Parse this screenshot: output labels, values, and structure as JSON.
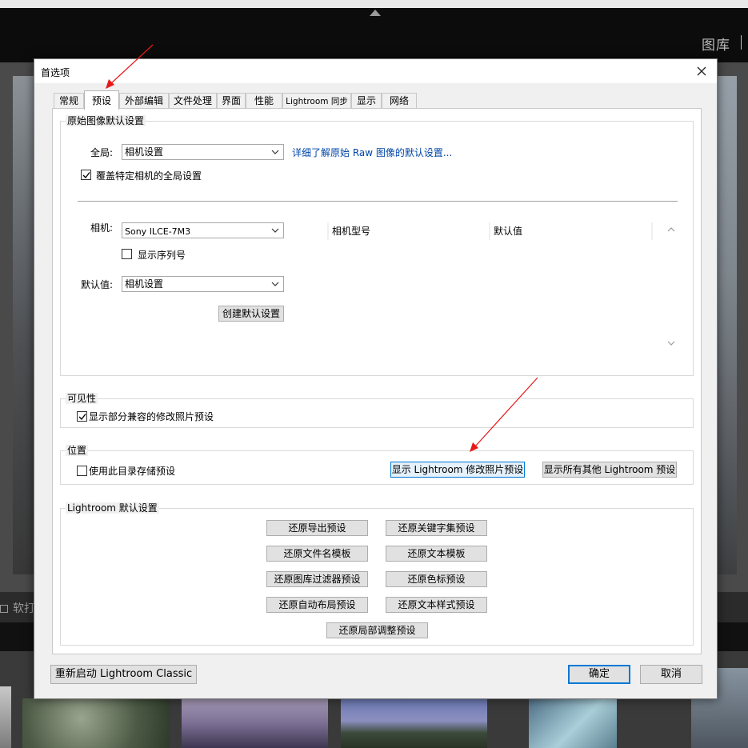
{
  "background": {
    "module_label": "图库",
    "toolbar_label": "软打"
  },
  "dialog": {
    "title": "首选项",
    "tabs": [
      {
        "label": "常规",
        "active": false
      },
      {
        "label": "预设",
        "active": true
      },
      {
        "label": "外部编辑",
        "active": false
      },
      {
        "label": "文件处理",
        "active": false
      },
      {
        "label": "界面",
        "active": false
      },
      {
        "label": "性能",
        "active": false
      },
      {
        "label": "Lightroom 同步",
        "active": false
      },
      {
        "label": "显示",
        "active": false
      },
      {
        "label": "网络",
        "active": false
      }
    ],
    "raw_defaults": {
      "group_label": "原始图像默认设置",
      "global_label": "全局:",
      "global_value": "相机设置",
      "learn_more_link": "详细了解原始 Raw 图像的默认设置...",
      "override_label": "覆盖特定相机的全局设置",
      "override_checked": true,
      "camera_label": "相机:",
      "camera_value": "Sony ILCE-7M3",
      "show_serial_label": "显示序列号",
      "show_serial_checked": false,
      "default_label": "默认值:",
      "default_value": "相机设置",
      "create_default_button": "创建默认设置",
      "table_headers": [
        "相机型号",
        "默认值"
      ]
    },
    "visibility": {
      "group_label": "可见性",
      "show_partial_label": "显示部分兼容的修改照片预设",
      "show_partial_checked": true
    },
    "location": {
      "group_label": "位置",
      "store_with_catalog_label": "使用此目录存储预设",
      "store_with_catalog_checked": false,
      "show_develop_presets_button": "显示 Lightroom 修改照片预设",
      "show_other_presets_button": "显示所有其他 Lightroom 预设"
    },
    "lightroom_defaults": {
      "group_label": "Lightroom 默认设置",
      "buttons": [
        "还原导出预设",
        "还原关键字集预设",
        "还原文件名模板",
        "还原文本模板",
        "还原图库过滤器预设",
        "还原色标预设",
        "还原自动布局预设",
        "还原文本样式预设",
        "还原局部调整预设"
      ]
    },
    "footer": {
      "restart_button": "重新启动 Lightroom Classic",
      "ok_button": "确定",
      "cancel_button": "取消"
    }
  },
  "colors": {
    "annotation_arrow": "#e8191a",
    "link": "#0046a8",
    "focus": "#0078d7"
  }
}
